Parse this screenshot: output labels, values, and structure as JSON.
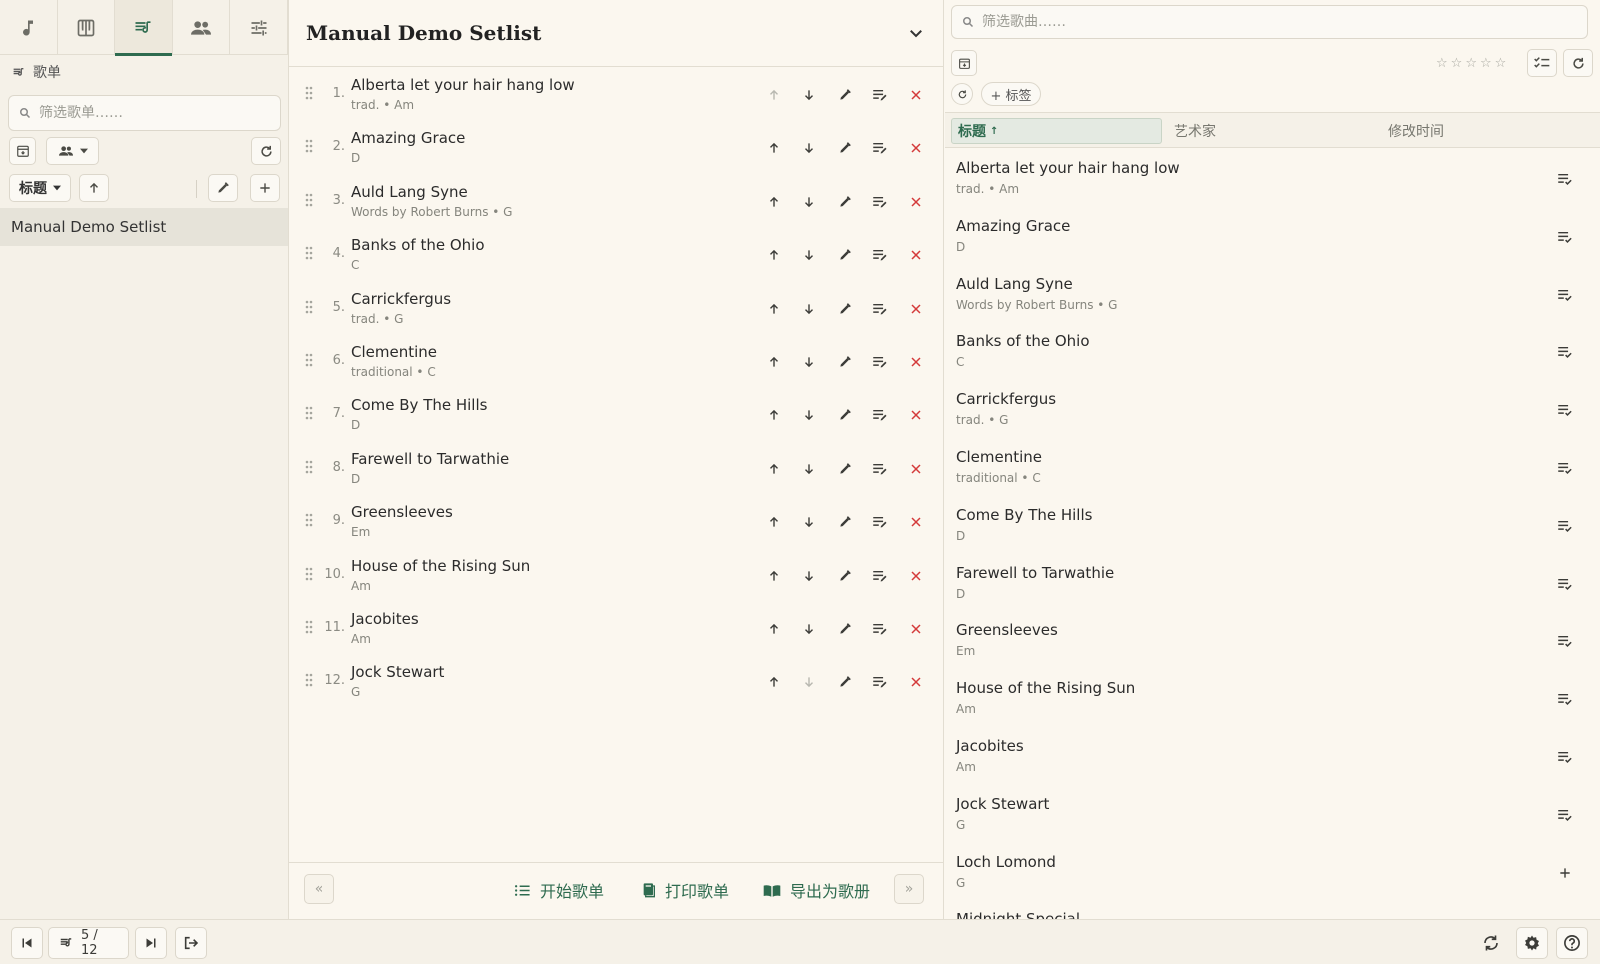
{
  "nav_tabs": [
    {
      "icon": "music-note-icon",
      "active": false
    },
    {
      "icon": "piano-icon",
      "active": false
    },
    {
      "icon": "setlist-icon",
      "active": true
    },
    {
      "icon": "people-icon",
      "active": false
    },
    {
      "icon": "sliders-icon",
      "active": false
    }
  ],
  "left": {
    "heading": "歌单",
    "filter_placeholder": "筛选歌单……",
    "sort_label": "标题",
    "setlists": [
      "Manual Demo Setlist"
    ]
  },
  "middle": {
    "title": "Manual Demo Setlist",
    "songs": [
      {
        "num": "1.",
        "title": "Alberta let your hair hang low",
        "sub": "trad. • Am"
      },
      {
        "num": "2.",
        "title": "Amazing Grace",
        "sub": "D"
      },
      {
        "num": "3.",
        "title": "Auld Lang Syne",
        "sub": "Words by Robert Burns • G"
      },
      {
        "num": "4.",
        "title": "Banks of the Ohio",
        "sub": "C"
      },
      {
        "num": "5.",
        "title": "Carrickfergus",
        "sub": "trad. • G"
      },
      {
        "num": "6.",
        "title": "Clementine",
        "sub": "traditional • C"
      },
      {
        "num": "7.",
        "title": "Come By The Hills",
        "sub": "D"
      },
      {
        "num": "8.",
        "title": "Farewell to Tarwathie",
        "sub": "D"
      },
      {
        "num": "9.",
        "title": "Greensleeves",
        "sub": "Em"
      },
      {
        "num": "10.",
        "title": "House of the Rising Sun",
        "sub": "Am"
      },
      {
        "num": "11.",
        "title": "Jacobites",
        "sub": "Am"
      },
      {
        "num": "12.",
        "title": "Jock Stewart",
        "sub": "G"
      }
    ],
    "footer": {
      "prev": "«",
      "next": "»",
      "start": "开始歌单",
      "print": "打印歌单",
      "export": "导出为歌册"
    }
  },
  "right": {
    "filter_placeholder": "筛选歌曲……",
    "tag_label": "+ 标签",
    "columns": {
      "title": "标题",
      "sort_indicator": "↑",
      "artist": "艺术家",
      "modified": "修改时间"
    },
    "songs": [
      {
        "title": "Alberta let your hair hang low",
        "sub": "trad. • Am",
        "in_setlist": true
      },
      {
        "title": "Amazing Grace",
        "sub": "D",
        "in_setlist": true
      },
      {
        "title": "Auld Lang Syne",
        "sub": "Words by Robert Burns • G",
        "in_setlist": true
      },
      {
        "title": "Banks of the Ohio",
        "sub": "C",
        "in_setlist": true
      },
      {
        "title": "Carrickfergus",
        "sub": "trad. • G",
        "in_setlist": true
      },
      {
        "title": "Clementine",
        "sub": "traditional • C",
        "in_setlist": true
      },
      {
        "title": "Come By The Hills",
        "sub": "D",
        "in_setlist": true
      },
      {
        "title": "Farewell to Tarwathie",
        "sub": "D",
        "in_setlist": true
      },
      {
        "title": "Greensleeves",
        "sub": "Em",
        "in_setlist": true
      },
      {
        "title": "House of the Rising Sun",
        "sub": "Am",
        "in_setlist": true
      },
      {
        "title": "Jacobites",
        "sub": "Am",
        "in_setlist": true
      },
      {
        "title": "Jock Stewart",
        "sub": "G",
        "in_setlist": true
      },
      {
        "title": "Loch Lomond",
        "sub": "G",
        "in_setlist": false
      },
      {
        "title": "Midnight Special",
        "sub": "",
        "in_setlist": false
      }
    ]
  },
  "bottom": {
    "position": "5 / 12"
  },
  "colors": {
    "accent": "#2e6b4f",
    "background": "#fbf7ef",
    "panel": "#f5f1e8",
    "delete": "#d43a3a"
  }
}
